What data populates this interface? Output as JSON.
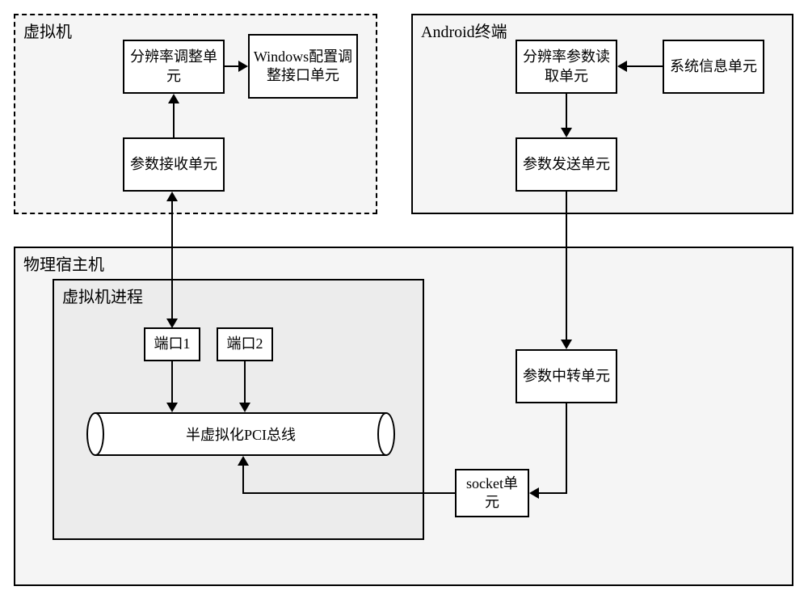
{
  "vm": {
    "title": "虚拟机",
    "resolution_adjust": "分辨率调整单元",
    "windows_config": "Windows配置调整接口单元",
    "param_receive": "参数接收单元"
  },
  "android": {
    "title": "Android终端",
    "resolution_read": "分辨率参数读取单元",
    "system_info": "系统信息单元",
    "param_send": "参数发送单元"
  },
  "host": {
    "title": "物理宿主机",
    "vm_process": {
      "title": "虚拟机进程",
      "port1": "端口1",
      "port2": "端口2",
      "pci_bus": "半虚拟化PCI总线"
    },
    "param_relay": "参数中转单元",
    "socket_unit": "socket单元"
  }
}
